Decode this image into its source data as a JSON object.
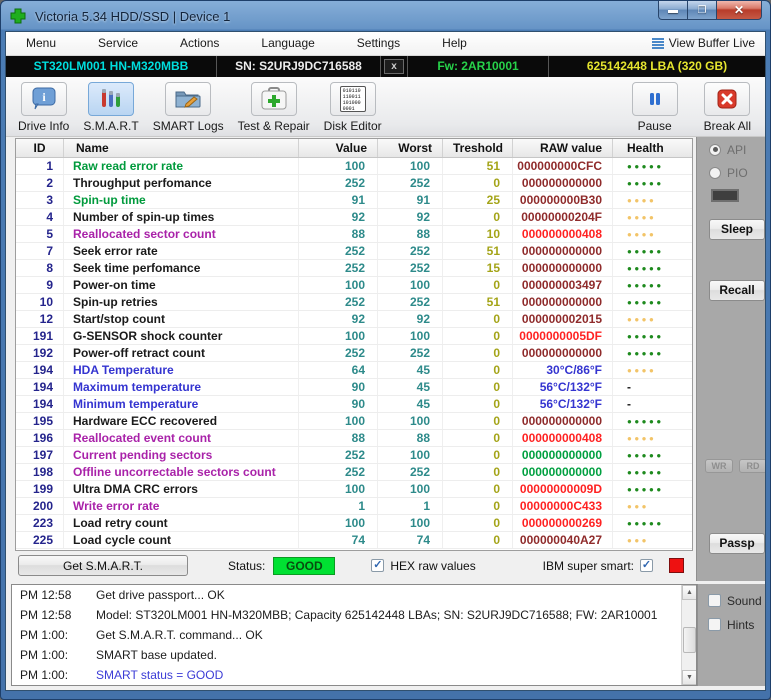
{
  "window": {
    "title": "Victoria 5.34 HDD/SSD | Device 1"
  },
  "menu": {
    "items": [
      "Menu",
      "Service",
      "Actions",
      "Language",
      "Settings",
      "Help"
    ],
    "view_buffer_label": "View Buffer Live"
  },
  "drive_bar": {
    "model": "ST320LM001 HN-M320MBB",
    "serial": "SN: S2URJ9DC716588",
    "x_button": "x",
    "firmware": "Fw: 2AR10001",
    "capacity": "625142448 LBA (320 GB)"
  },
  "toolbar": {
    "buttons": [
      {
        "label": "Drive Info"
      },
      {
        "label": "S.M.A.R.T"
      },
      {
        "label": "SMART Logs"
      },
      {
        "label": "Test & Repair"
      },
      {
        "label": "Disk Editor"
      }
    ],
    "disk_editor_bits": [
      "010110",
      "110011",
      "101000",
      "0001"
    ],
    "pause_label": "Pause",
    "break_all_label": "Break All"
  },
  "table": {
    "headers": [
      "ID",
      "Name",
      "Value",
      "Worst",
      "Treshold",
      "RAW value",
      "Health"
    ],
    "rows": [
      {
        "id": "1",
        "name": "Raw read error rate",
        "name_color": "green",
        "value": "100",
        "worst": "100",
        "threshold": "51",
        "raw": "000000000CFC",
        "raw_color": "darkred",
        "health": {
          "count": 5,
          "color": "green"
        }
      },
      {
        "id": "2",
        "name": "Throughput perfomance",
        "name_color": "black",
        "value": "252",
        "worst": "252",
        "threshold": "0",
        "raw": "000000000000",
        "raw_color": "darkred",
        "health": {
          "count": 5,
          "color": "green"
        }
      },
      {
        "id": "3",
        "name": "Spin-up time",
        "name_color": "green",
        "value": "91",
        "worst": "91",
        "threshold": "25",
        "raw": "000000000B30",
        "raw_color": "darkred",
        "health": {
          "count": 4,
          "color": "orange"
        }
      },
      {
        "id": "4",
        "name": "Number of spin-up times",
        "name_color": "black",
        "value": "92",
        "worst": "92",
        "threshold": "0",
        "raw": "00000000204F",
        "raw_color": "darkred",
        "health": {
          "count": 4,
          "color": "orange"
        }
      },
      {
        "id": "5",
        "name": "Reallocated sector count",
        "name_color": "magenta",
        "value": "88",
        "worst": "88",
        "threshold": "10",
        "raw": "000000000408",
        "raw_color": "red",
        "health": {
          "count": 4,
          "color": "orange"
        }
      },
      {
        "id": "7",
        "name": "Seek error rate",
        "name_color": "black",
        "value": "252",
        "worst": "252",
        "threshold": "51",
        "raw": "000000000000",
        "raw_color": "darkred",
        "health": {
          "count": 5,
          "color": "green"
        }
      },
      {
        "id": "8",
        "name": "Seek time perfomance",
        "name_color": "black",
        "value": "252",
        "worst": "252",
        "threshold": "15",
        "raw": "000000000000",
        "raw_color": "darkred",
        "health": {
          "count": 5,
          "color": "green"
        }
      },
      {
        "id": "9",
        "name": "Power-on time",
        "name_color": "black",
        "value": "100",
        "worst": "100",
        "threshold": "0",
        "raw": "000000003497",
        "raw_color": "darkred",
        "health": {
          "count": 5,
          "color": "green"
        }
      },
      {
        "id": "10",
        "name": "Spin-up retries",
        "name_color": "black",
        "value": "252",
        "worst": "252",
        "threshold": "51",
        "raw": "000000000000",
        "raw_color": "darkred",
        "health": {
          "count": 5,
          "color": "green"
        }
      },
      {
        "id": "12",
        "name": "Start/stop count",
        "name_color": "black",
        "value": "92",
        "worst": "92",
        "threshold": "0",
        "raw": "000000002015",
        "raw_color": "darkred",
        "health": {
          "count": 4,
          "color": "orange"
        }
      },
      {
        "id": "191",
        "name": "G-SENSOR shock counter",
        "name_color": "black",
        "value": "100",
        "worst": "100",
        "threshold": "0",
        "raw": "0000000005DF",
        "raw_color": "red",
        "health": {
          "count": 5,
          "color": "green"
        }
      },
      {
        "id": "192",
        "name": "Power-off retract count",
        "name_color": "black",
        "value": "252",
        "worst": "252",
        "threshold": "0",
        "raw": "000000000000",
        "raw_color": "darkred",
        "health": {
          "count": 5,
          "color": "green"
        }
      },
      {
        "id": "194",
        "name": "HDA Temperature",
        "name_color": "blue",
        "value": "64",
        "worst": "45",
        "threshold": "0",
        "raw": "30°C/86°F",
        "raw_color": "blue",
        "health": {
          "count": 4,
          "color": "orange"
        }
      },
      {
        "id": "194",
        "name": "Maximum temperature",
        "name_color": "blue",
        "value": "90",
        "worst": "45",
        "threshold": "0",
        "raw": "56°C/132°F",
        "raw_color": "blue",
        "health": {
          "dash": true
        }
      },
      {
        "id": "194",
        "name": "Minimum temperature",
        "name_color": "blue",
        "value": "90",
        "worst": "45",
        "threshold": "0",
        "raw": "56°C/132°F",
        "raw_color": "blue",
        "health": {
          "dash": true
        }
      },
      {
        "id": "195",
        "name": "Hardware ECC recovered",
        "name_color": "black",
        "value": "100",
        "worst": "100",
        "threshold": "0",
        "raw": "000000000000",
        "raw_color": "darkred",
        "health": {
          "count": 5,
          "color": "green"
        }
      },
      {
        "id": "196",
        "name": "Reallocated event count",
        "name_color": "magenta",
        "value": "88",
        "worst": "88",
        "threshold": "0",
        "raw": "000000000408",
        "raw_color": "red",
        "health": {
          "count": 4,
          "color": "orange"
        }
      },
      {
        "id": "197",
        "name": "Current pending sectors",
        "name_color": "magenta",
        "value": "252",
        "worst": "100",
        "threshold": "0",
        "raw": "000000000000",
        "raw_color": "green",
        "health": {
          "count": 5,
          "color": "green"
        }
      },
      {
        "id": "198",
        "name": "Offline uncorrectable sectors count",
        "name_color": "magenta",
        "value": "252",
        "worst": "252",
        "threshold": "0",
        "raw": "000000000000",
        "raw_color": "green",
        "health": {
          "count": 5,
          "color": "green"
        }
      },
      {
        "id": "199",
        "name": "Ultra DMA CRC errors",
        "name_color": "black",
        "value": "100",
        "worst": "100",
        "threshold": "0",
        "raw": "00000000009D",
        "raw_color": "red",
        "health": {
          "count": 5,
          "color": "green"
        }
      },
      {
        "id": "200",
        "name": "Write error rate",
        "name_color": "magenta",
        "value": "1",
        "worst": "1",
        "threshold": "0",
        "raw": "00000000C433",
        "raw_color": "red",
        "health": {
          "count": 3,
          "color": "orange"
        }
      },
      {
        "id": "223",
        "name": "Load retry count",
        "name_color": "black",
        "value": "100",
        "worst": "100",
        "threshold": "0",
        "raw": "000000000269",
        "raw_color": "red",
        "health": {
          "count": 5,
          "color": "green"
        }
      },
      {
        "id": "225",
        "name": "Load cycle count",
        "name_color": "black",
        "value": "74",
        "worst": "74",
        "threshold": "0",
        "raw": "000000040A27",
        "raw_color": "darkred",
        "health": {
          "count": 3,
          "color": "orange"
        }
      }
    ]
  },
  "side_panel": {
    "api_label": "API",
    "pio_label": "PIO",
    "sleep_label": "Sleep",
    "recall_label": "Recall",
    "wr_label": "WR",
    "rd_label": "RD",
    "passp_label": "Passp"
  },
  "status_bar": {
    "get_smart_label": "Get S.M.A.R.T.",
    "status_label": "Status:",
    "status_value": "GOOD",
    "hex_label": "HEX raw values",
    "ibm_label": "IBM super smart:",
    "check_glyph": "✓"
  },
  "log": {
    "entries": [
      {
        "time": "PM 12:58",
        "text": "Get drive passport... OK",
        "color": "black"
      },
      {
        "time": "PM 12:58",
        "text": "Model: ST320LM001 HN-M320MBB; Capacity 625142448 LBAs; SN: S2URJ9DC716588; FW: 2AR10001",
        "color": "black"
      },
      {
        "time": "PM 1:00:",
        "text": "Get S.M.A.R.T. command... OK",
        "color": "black"
      },
      {
        "time": "PM 1:00:",
        "text": "SMART base updated.",
        "color": "black"
      },
      {
        "time": "PM 1:00:",
        "text": "SMART status = GOOD",
        "color": "blue"
      }
    ]
  },
  "misc_panel": {
    "sound_label": "Sound",
    "hints_label": "Hints"
  },
  "colors": {
    "id_navy": "#24248c",
    "name_green": "#009a3c",
    "name_black": "#1a1a1a",
    "name_magenta": "#a922a9",
    "name_blue": "#3434d0",
    "value_teal": "#2d8a8a",
    "threshold_olive": "#a4a418",
    "raw_darkred": "#8f2b2b",
    "raw_red": "#ff2222",
    "raw_green": "#00a040",
    "raw_blue": "#3434d0",
    "dot_green": "#1e8a1e",
    "dot_orange": "#f2c468",
    "status_good_bg": "#00e132",
    "led_red": "#ee1111"
  }
}
